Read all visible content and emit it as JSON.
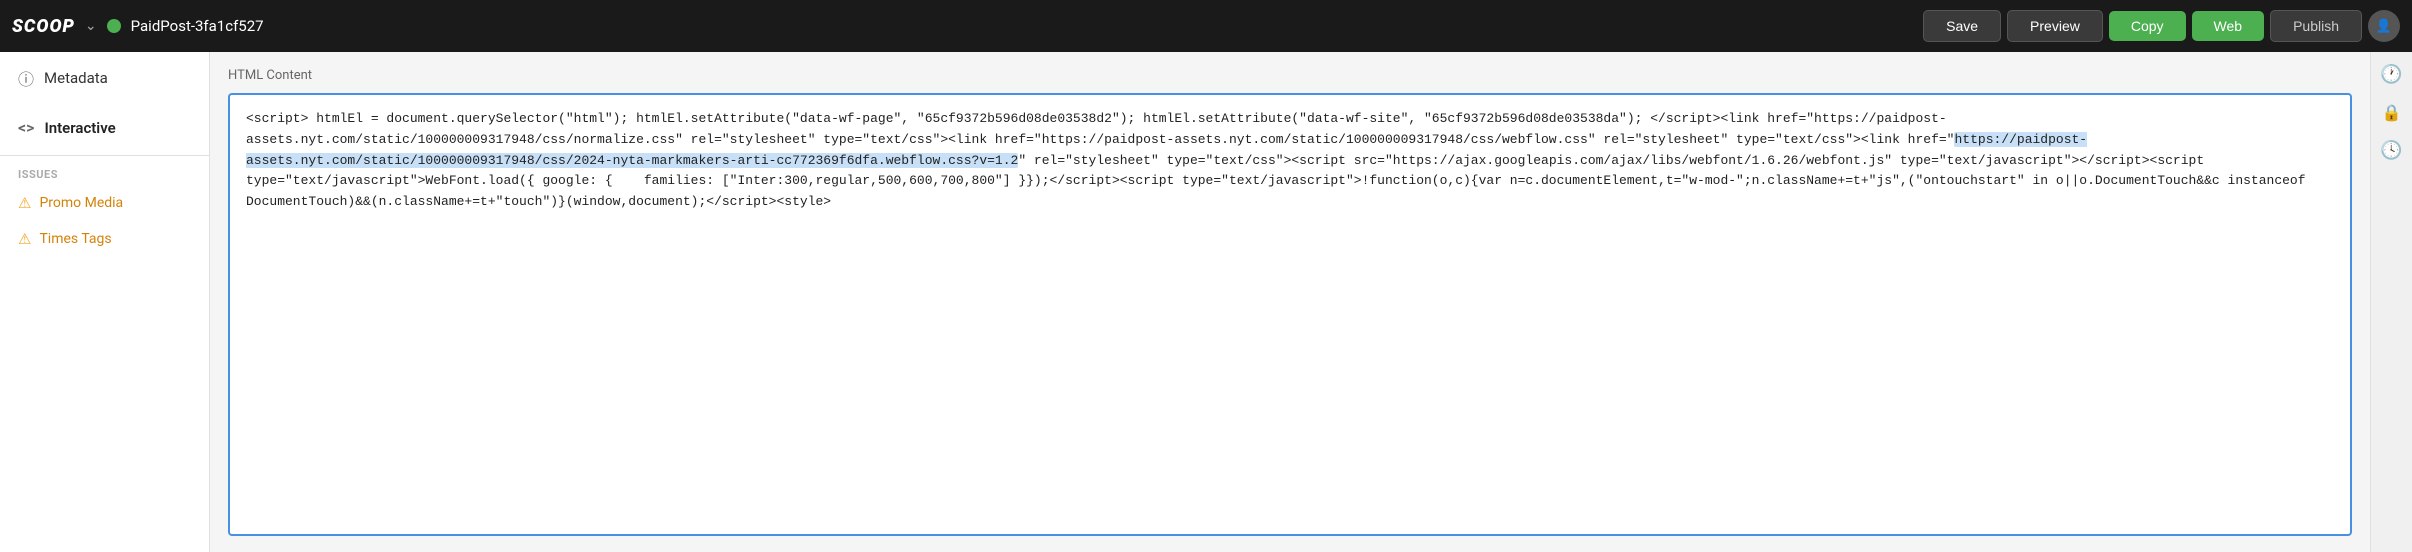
{
  "topbar": {
    "logo": "SCOOP",
    "doc_name": "PaidPost-3fa1cf527",
    "save_label": "Save",
    "preview_label": "Preview",
    "copy_label": "Copy",
    "web_label": "Web",
    "publish_label": "Publish"
  },
  "sidebar": {
    "metadata_label": "Metadata",
    "interactive_label": "Interactive",
    "issues_section": "ISSUES",
    "issues": [
      {
        "label": "Promo Media"
      },
      {
        "label": "Times Tags"
      }
    ]
  },
  "content": {
    "section_label": "HTML Content",
    "html_text": "<script> htmlEl = document.querySelector(\"html\"); htmlEl.setAttribute(\"data-wf-page\", \"65cf9372b596d08de03538d2\"); htmlEl.setAttribute(\"data-wf-site\", \"65cf9372b596d08de03538da\"); </script><link href=\"https://paidpost-assets.nyt.com/static/100000009317948/css/normalize.css\" rel=\"stylesheet\" type=\"text/css\"><link href=\"https://paidpost-assets.nyt.com/static/100000009317948/css/webflow.css\" rel=\"stylesheet\" type=\"text/css\"><link href=\"https://paidpost-assets.nyt.com/static/100000009317948/css/2024-nyta-markmakers-arti-cc772369f6dfa.webflow.css?v=1.2\" rel=\"stylesheet\" type=\"text/css\"><script src=\"https://ajax.googleapis.com/ajax/libs/webfont/1.6.26/webfont.js\" type=\"text/javascript\"></script><script type=\"text/javascript\">WebFont.load({ google: { families: [\"Inter:300,regular,500,600,700,800\"] }});</script><script type=\"text/javascript\">!function(o,c){var n=c.documentElement,t=\"w-mod-\";n.className+=t+\"js\",(\"ontouchstart\"in o||o.DocumentTouch&&c instanceof DocumentTouch)&&(n.className+=t+\"touch\")}(window,document);</script><style>"
  }
}
